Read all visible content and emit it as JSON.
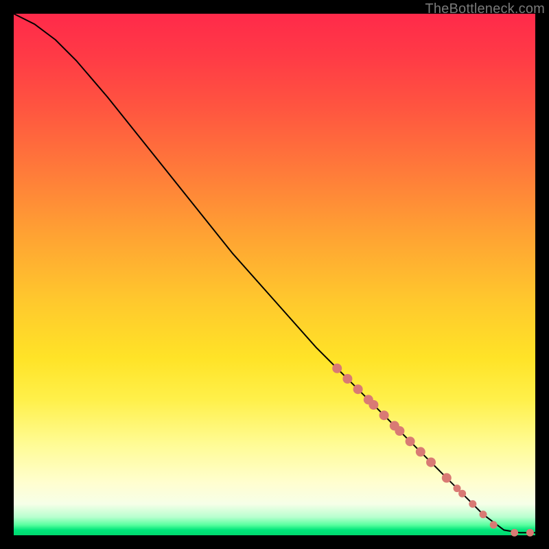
{
  "watermark": "TheBottleneck.com",
  "colors": {
    "curve": "#000000",
    "marker_fill": "#d97a74",
    "marker_stroke": "#b85a54"
  },
  "chart_data": {
    "type": "line",
    "title": "",
    "xlabel": "",
    "ylabel": "",
    "xlim": [
      0,
      100
    ],
    "ylim": [
      0,
      100
    ],
    "grid": false,
    "legend": false,
    "series": [
      {
        "name": "bottleneck-curve",
        "x": [
          0,
          4,
          8,
          12,
          18,
          26,
          34,
          42,
          50,
          58,
          65,
          70,
          74,
          78,
          82,
          86,
          90,
          94,
          97,
          100
        ],
        "y": [
          100,
          98,
          95,
          91,
          84,
          74,
          64,
          54,
          45,
          36,
          29,
          24,
          20,
          16,
          12,
          8,
          4,
          1,
          0.5,
          0.5
        ]
      }
    ],
    "markers": {
      "name": "highlighted-points",
      "x": [
        62,
        64,
        66,
        68,
        69,
        71,
        73,
        74,
        76,
        78,
        80,
        83,
        85,
        86,
        88,
        90,
        92,
        96,
        99
      ],
      "y": [
        32,
        30,
        28,
        26,
        25,
        23,
        21,
        20,
        18,
        16,
        14,
        11,
        9,
        8,
        6,
        4,
        2,
        0.5,
        0.5
      ],
      "r_large_until_index": 11
    }
  }
}
